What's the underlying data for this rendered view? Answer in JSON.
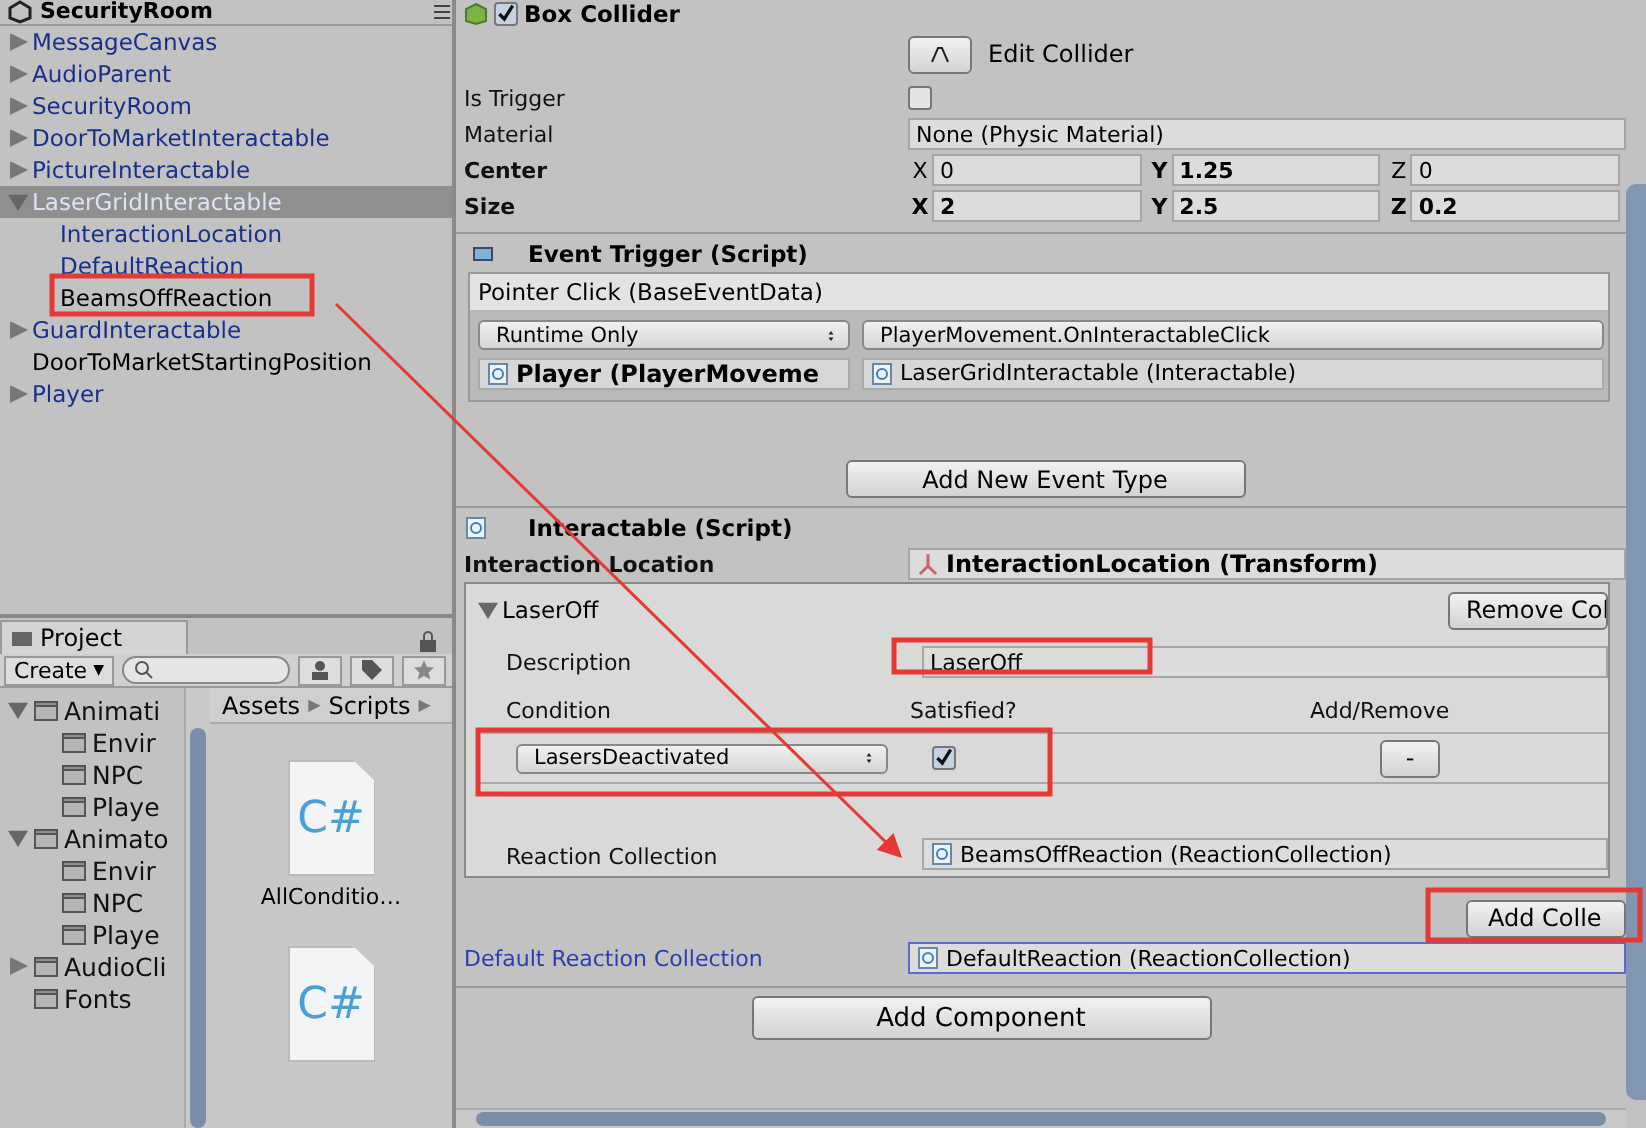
{
  "hierarchy": {
    "scene": "SecurityRoom",
    "items": [
      {
        "name": "MessageCanvas",
        "expandable": true,
        "expanded": false,
        "selected": false,
        "color": "#1a2f8a"
      },
      {
        "name": "AudioParent",
        "expandable": true,
        "expanded": false,
        "selected": false,
        "color": "#1a2f8a"
      },
      {
        "name": "SecurityRoom",
        "expandable": true,
        "expanded": false,
        "selected": false,
        "color": "#1a2f8a"
      },
      {
        "name": "DoorToMarketInteractable",
        "expandable": true,
        "expanded": false,
        "selected": false,
        "color": "#1a2f8a"
      },
      {
        "name": "PictureInteractable",
        "expandable": true,
        "expanded": false,
        "selected": false,
        "color": "#1a2f8a"
      },
      {
        "name": "LaserGridInteractable",
        "expandable": true,
        "expanded": true,
        "selected": true,
        "color": "#dde4f8",
        "children": [
          {
            "name": "InteractionLocation",
            "expandable": false,
            "selected": false,
            "color": "#1a2f8a"
          },
          {
            "name": "DefaultReaction",
            "expandable": false,
            "selected": false,
            "color": "#1a2f8a"
          },
          {
            "name": "BeamsOffReaction",
            "expandable": false,
            "selected": false,
            "color": "#000000"
          }
        ]
      },
      {
        "name": "GuardInteractable",
        "expandable": true,
        "expanded": false,
        "selected": false,
        "color": "#1a2f8a"
      },
      {
        "name": "DoorToMarketStartingPosition",
        "expandable": false,
        "selected": false,
        "color": "#000000"
      },
      {
        "name": "Player",
        "expandable": true,
        "expanded": false,
        "selected": false,
        "color": "#1a2f8a"
      }
    ]
  },
  "project": {
    "tab": "Project",
    "create": "Create",
    "create_caret": "▼",
    "breadcrumb": [
      {
        "label": "Assets",
        "sep": "▶"
      },
      {
        "label": "Scripts",
        "sep": "▶"
      }
    ],
    "folders": [
      {
        "name": "Animati",
        "expandable": true,
        "expanded": true,
        "children": [
          {
            "name": "Envir",
            "expandable": false
          },
          {
            "name": "NPC",
            "expandable": false
          },
          {
            "name": "Playe",
            "expandable": false
          }
        ]
      },
      {
        "name": "Animato",
        "expandable": true,
        "expanded": true,
        "children": [
          {
            "name": "Envir",
            "expandable": false
          },
          {
            "name": "NPC",
            "expandable": false
          },
          {
            "name": "Playe",
            "expandable": false
          }
        ]
      },
      {
        "name": "AudioCli",
        "expandable": true,
        "expanded": false
      },
      {
        "name": "Fonts",
        "expandable": false
      }
    ],
    "assets": [
      {
        "icon_label": "C#",
        "name": "AllConditio…"
      },
      {
        "icon_label": "C#"
      }
    ]
  },
  "inspector": {
    "box_collider": {
      "title": "Box Collider",
      "enabled": true,
      "edit_button": "Edit Collider",
      "is_trigger": {
        "label": "Is Trigger",
        "checked": false
      },
      "material": {
        "label": "Material",
        "value": "None (Physic Material)"
      },
      "vectors": [
        {
          "label": "Center",
          "axes": [
            {
              "axis": "X",
              "bold": false,
              "value": "0"
            },
            {
              "axis": "Y",
              "bold": true,
              "value": "1.25"
            },
            {
              "axis": "Z",
              "bold": false,
              "value": "0"
            }
          ]
        },
        {
          "label": "Size",
          "axes": [
            {
              "axis": "X",
              "bold": true,
              "value": "2"
            },
            {
              "axis": "Y",
              "bold": true,
              "value": "2.5"
            },
            {
              "axis": "Z",
              "bold": true,
              "value": "0.2"
            }
          ]
        }
      ]
    },
    "event_trigger": {
      "title": "Event Trigger (Script)",
      "event": "Pointer Click (BaseEventData)",
      "mode": "Runtime Only",
      "function": "PlayerMovement.OnInteractableClick",
      "object": "Player (PlayerMoveme",
      "argument": "LaserGridInteractable (Interactable)",
      "add_button": "Add New Event Type"
    },
    "interactable": {
      "title": "Interactable (Script)",
      "location_label": "Interaction Location",
      "location_value": "InteractionLocation (Transform)",
      "collection": {
        "name": "LaserOff",
        "expanded": true,
        "remove_button": "Remove Col",
        "description_label": "Description",
        "description": "LaserOff",
        "headers": [
          "Condition",
          "Satisfied?",
          "Add/Remove"
        ],
        "conditions": [
          {
            "name": "LasersDeactivated",
            "satisfied": true,
            "remove": "-"
          }
        ],
        "reaction_label": "Reaction Collection",
        "reaction": "BeamsOffReaction (ReactionCollection)"
      },
      "add_button": "Add Colle",
      "default_label": "Default Reaction Collection",
      "default_value": "DefaultReaction (ReactionCollection)"
    },
    "add_component": "Add Component"
  }
}
